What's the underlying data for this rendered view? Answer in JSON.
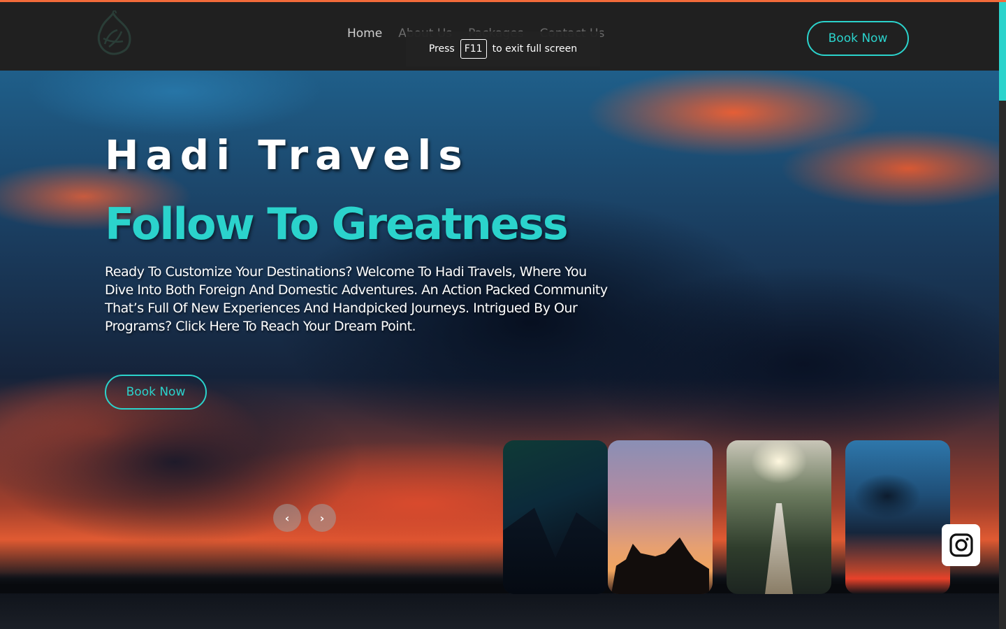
{
  "header": {
    "logo_icon": "calligraphy-logo-icon",
    "nav": [
      {
        "label": "Home"
      },
      {
        "label": "About Us"
      },
      {
        "label": "Packages"
      },
      {
        "label": "Contact Us"
      }
    ],
    "book_label": "Book Now"
  },
  "fullscreen_notice": {
    "prefix": "Press",
    "key": "F11",
    "suffix": "to exit full screen"
  },
  "hero": {
    "title": "Hadi Travels",
    "tagline": "Follow To Greatness",
    "description": "Ready To Customize Your Destinations? Welcome To Hadi Travels, Where You Dive Into Both Foreign And Domestic Adventures. An Action Packed Community That’s Full Of New Experiences And Handpicked Journeys. Intrigued By Our Programs? Click Here To Reach Your Dream Point.",
    "book_label": "Book Now",
    "prev_icon": "chevron-left-icon",
    "next_icon": "chevron-right-icon"
  },
  "slides": [
    {
      "icon": "northern-lights-photo"
    },
    {
      "icon": "cyclists-sunset-photo"
    },
    {
      "icon": "suspension-bridge-photo"
    },
    {
      "icon": "sunset-clouds-photo"
    }
  ],
  "social": {
    "icon": "instagram-icon"
  },
  "colors": {
    "accent": "#2bd3cc",
    "header_bg": "#202020",
    "top_line": "#f26b3a"
  }
}
